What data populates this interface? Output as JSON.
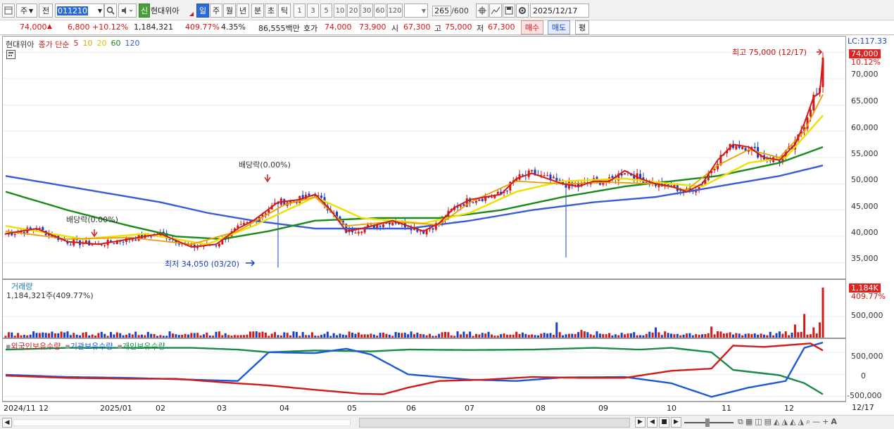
{
  "toolbar": {
    "period_type": "주",
    "prev_label": "전",
    "code": "011210",
    "credit_badge": "신",
    "stock_name": "현대위아",
    "periods": [
      "일",
      "주",
      "월",
      "년",
      "분",
      "초",
      "틱"
    ],
    "active_period": "일",
    "numbers": [
      "1",
      "3",
      "5",
      "10",
      "20",
      "30",
      "60",
      "120"
    ],
    "count": "265",
    "count_total": "/600",
    "date": "2025/12/17"
  },
  "quote": {
    "price": "74,000",
    "change": "6,800",
    "change_pct": "+10.12%",
    "volume": "1,184,321",
    "volume_ratio": "409.77%",
    "turnover": "4.35%",
    "amount": "86,555백만",
    "bid_label": "호가",
    "ask": "74,000",
    "bid": "73,900",
    "open_label": "시",
    "open": "67,300",
    "high_label": "고",
    "high": "75,000",
    "low_label": "저",
    "low": "67,300",
    "buy_label": "매수",
    "sell_label": "매도",
    "eval_label": "평"
  },
  "price_panel": {
    "legend": [
      "현대위아",
      "종가 단순",
      "5",
      "10",
      "20",
      "60",
      "120"
    ],
    "legend_colors": [
      "#333333",
      "#d11a1a",
      "#d11a1a",
      "#e8a000",
      "#e8d800",
      "#1a8a1a",
      "#3a5ad8"
    ],
    "high_annot": "최고 75,000 (12/17)",
    "low_annot": "최저 34,050 (03/20)",
    "div_annot_1": "배당락(0.00%)",
    "div_annot_2": "배당락(0.00%)",
    "lc_label": "LC:117.33",
    "price_tag": "74,000",
    "pct_tag": "10.12%"
  },
  "volume_panel": {
    "title": "거래량",
    "value": "1,184,321주(409.77%)",
    "tag_k": "1,184K",
    "tag_pct": "409.77%"
  },
  "holders_panel": {
    "legend": [
      "외국인보유수량",
      "기관보유수량",
      "개인보유수량"
    ],
    "legend_colors": [
      "#d11a1a",
      "#1a5ad8",
      "#1a8a4a"
    ]
  },
  "price_axis": [
    "70,000",
    "65,000",
    "60,000",
    "55,000",
    "50,000",
    "45,000",
    "40,000",
    "35,000"
  ],
  "volume_axis": [
    "500,000"
  ],
  "holders_axis": [
    "500,000",
    "0",
    "-500,000"
  ],
  "date_axis": [
    "2024/11",
    "12",
    "2025/01",
    "02",
    "03",
    "04",
    "05",
    "06",
    "07",
    "08",
    "09",
    "10",
    "11",
    "12"
  ],
  "date_axis_end": "12/17",
  "chart_data": {
    "type": "candlestick",
    "price_ylim": [
      32000,
      78000
    ],
    "close_points": [
      [
        0,
        40500
      ],
      [
        10,
        41500
      ],
      [
        20,
        39000
      ],
      [
        30,
        38500
      ],
      [
        40,
        39500
      ],
      [
        50,
        40500
      ],
      [
        60,
        38000
      ],
      [
        68,
        38500
      ],
      [
        75,
        41500
      ],
      [
        80,
        43000
      ],
      [
        88,
        46500
      ],
      [
        95,
        47000
      ],
      [
        100,
        48000
      ],
      [
        105,
        45000
      ],
      [
        110,
        41000
      ],
      [
        115,
        41500
      ],
      [
        125,
        43000
      ],
      [
        130,
        42000
      ],
      [
        135,
        41000
      ],
      [
        140,
        42500
      ],
      [
        145,
        45500
      ],
      [
        150,
        47000
      ],
      [
        155,
        47500
      ],
      [
        160,
        48000
      ],
      [
        165,
        51000
      ],
      [
        170,
        52000
      ],
      [
        175,
        51000
      ],
      [
        180,
        50000
      ],
      [
        185,
        49500
      ],
      [
        190,
        50500
      ],
      [
        195,
        50500
      ],
      [
        200,
        52500
      ],
      [
        205,
        51000
      ],
      [
        210,
        50000
      ],
      [
        215,
        49500
      ],
      [
        220,
        48500
      ],
      [
        225,
        50000
      ],
      [
        230,
        54500
      ],
      [
        235,
        57500
      ],
      [
        240,
        57000
      ],
      [
        245,
        55000
      ],
      [
        250,
        54500
      ],
      [
        255,
        57500
      ],
      [
        258,
        61500
      ],
      [
        261,
        66500
      ],
      [
        263,
        67300
      ],
      [
        264,
        74000
      ]
    ],
    "ma5_points": [
      [
        0,
        41000
      ],
      [
        20,
        39500
      ],
      [
        40,
        39800
      ],
      [
        60,
        38500
      ],
      [
        75,
        41000
      ],
      [
        90,
        46000
      ],
      [
        100,
        47500
      ],
      [
        110,
        42000
      ],
      [
        125,
        42800
      ],
      [
        140,
        42200
      ],
      [
        150,
        46500
      ],
      [
        165,
        50500
      ],
      [
        180,
        50000
      ],
      [
        195,
        50300
      ],
      [
        210,
        50000
      ],
      [
        220,
        48800
      ],
      [
        230,
        53500
      ],
      [
        240,
        56500
      ],
      [
        250,
        55000
      ],
      [
        258,
        60000
      ],
      [
        264,
        67000
      ]
    ],
    "ma20_points": [
      [
        0,
        42000
      ],
      [
        25,
        39500
      ],
      [
        45,
        40500
      ],
      [
        65,
        38500
      ],
      [
        80,
        42000
      ],
      [
        100,
        47500
      ],
      [
        115,
        43500
      ],
      [
        135,
        42500
      ],
      [
        150,
        44500
      ],
      [
        165,
        48500
      ],
      [
        180,
        50500
      ],
      [
        200,
        51000
      ],
      [
        215,
        50000
      ],
      [
        225,
        49500
      ],
      [
        240,
        54000
      ],
      [
        252,
        55000
      ],
      [
        264,
        63000
      ]
    ],
    "ma60_points": [
      [
        0,
        48500
      ],
      [
        20,
        45000
      ],
      [
        40,
        42000
      ],
      [
        55,
        40000
      ],
      [
        70,
        39500
      ],
      [
        85,
        41000
      ],
      [
        100,
        43000
      ],
      [
        120,
        43500
      ],
      [
        140,
        43500
      ],
      [
        160,
        45000
      ],
      [
        180,
        47500
      ],
      [
        200,
        49500
      ],
      [
        215,
        50500
      ],
      [
        230,
        51500
      ],
      [
        250,
        54000
      ],
      [
        264,
        57000
      ]
    ],
    "ma120_points": [
      [
        0,
        51500
      ],
      [
        25,
        49000
      ],
      [
        50,
        46500
      ],
      [
        65,
        44500
      ],
      [
        80,
        43000
      ],
      [
        100,
        41500
      ],
      [
        130,
        41500
      ],
      [
        150,
        43000
      ],
      [
        170,
        45000
      ],
      [
        190,
        46500
      ],
      [
        210,
        47500
      ],
      [
        230,
        49500
      ],
      [
        250,
        51500
      ],
      [
        264,
        53500
      ]
    ],
    "volume_spikes": [
      [
        103,
        90000
      ],
      [
        178,
        360000
      ],
      [
        186,
        180000
      ],
      [
        210,
        240000
      ],
      [
        228,
        260000
      ],
      [
        255,
        310000
      ],
      [
        258,
        560000
      ],
      [
        261,
        240000
      ],
      [
        263,
        360000
      ],
      [
        264,
        1184321
      ]
    ],
    "foreign_points": [
      [
        0,
        -30000
      ],
      [
        20,
        -80000
      ],
      [
        40,
        -100000
      ],
      [
        55,
        -100000
      ],
      [
        70,
        -180000
      ],
      [
        85,
        -250000
      ],
      [
        100,
        -350000
      ],
      [
        115,
        -440000
      ],
      [
        122,
        -450000
      ],
      [
        130,
        -300000
      ],
      [
        140,
        -150000
      ],
      [
        155,
        -120000
      ],
      [
        170,
        -60000
      ],
      [
        185,
        -80000
      ],
      [
        200,
        -80000
      ],
      [
        215,
        80000
      ],
      [
        228,
        130000
      ],
      [
        235,
        650000
      ],
      [
        245,
        620000
      ],
      [
        260,
        700000
      ],
      [
        264,
        540000
      ]
    ],
    "institution_points": [
      [
        0,
        -10000
      ],
      [
        20,
        -60000
      ],
      [
        40,
        -80000
      ],
      [
        60,
        -120000
      ],
      [
        75,
        -150000
      ],
      [
        85,
        500000
      ],
      [
        100,
        480000
      ],
      [
        110,
        580000
      ],
      [
        118,
        450000
      ],
      [
        130,
        0
      ],
      [
        150,
        -120000
      ],
      [
        165,
        -150000
      ],
      [
        180,
        -70000
      ],
      [
        200,
        -60000
      ],
      [
        215,
        -200000
      ],
      [
        228,
        -510000
      ],
      [
        240,
        -300000
      ],
      [
        252,
        -150000
      ],
      [
        258,
        600000
      ],
      [
        264,
        720000
      ]
    ],
    "individual_points": [
      [
        0,
        560000
      ],
      [
        20,
        600000
      ],
      [
        40,
        600000
      ],
      [
        60,
        600000
      ],
      [
        75,
        560000
      ],
      [
        85,
        500000
      ],
      [
        100,
        540000
      ],
      [
        118,
        520000
      ],
      [
        130,
        560000
      ],
      [
        150,
        550000
      ],
      [
        170,
        560000
      ],
      [
        190,
        600000
      ],
      [
        205,
        560000
      ],
      [
        215,
        600000
      ],
      [
        228,
        500000
      ],
      [
        235,
        100000
      ],
      [
        250,
        -20000
      ],
      [
        258,
        -200000
      ],
      [
        264,
        -450000
      ]
    ],
    "holders_ylim": [
      -600000,
      800000
    ],
    "volume_ylim": [
      0,
      1200000
    ]
  }
}
